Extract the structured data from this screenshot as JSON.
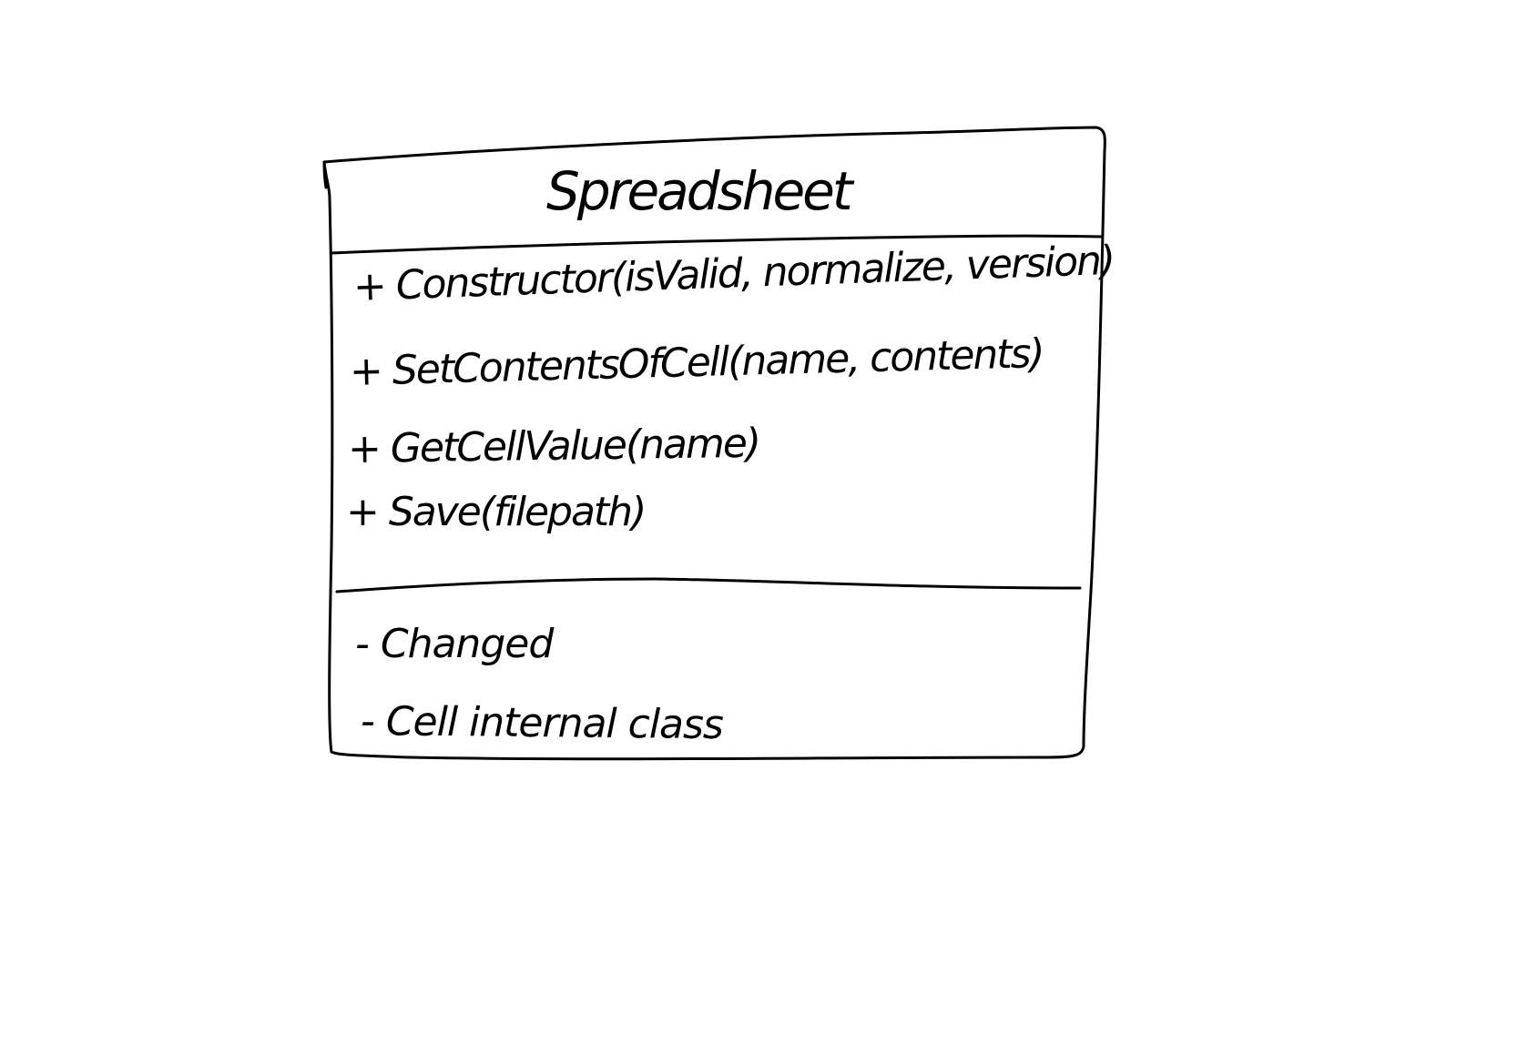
{
  "diagram": {
    "type": "uml-class",
    "class_name": "Spreadsheet",
    "methods": [
      "+ Constructor(isValid, normalize, version)",
      "+ SetContentsOfCell(name, contents)",
      "+ GetCellValue(name)",
      "+ Save(filepath)"
    ],
    "fields": [
      "- Changed",
      "- Cell internal class"
    ],
    "colors": {
      "ink": "#000000",
      "background": "#ffffff"
    }
  }
}
